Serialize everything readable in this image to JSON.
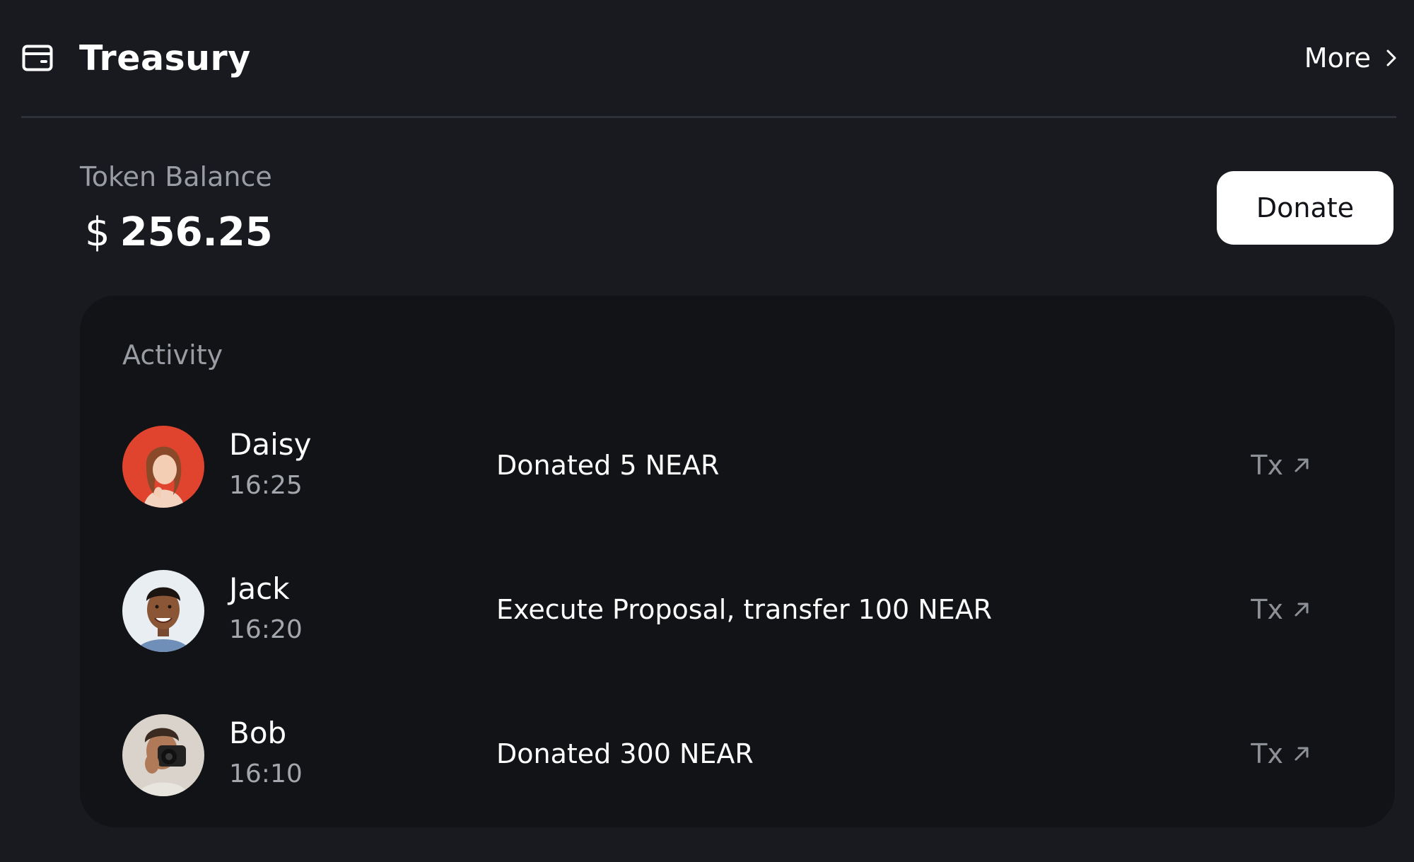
{
  "header": {
    "icon": "wallet-icon",
    "title": "Treasury",
    "more_label": "More",
    "more_icon": "chevron-right-icon"
  },
  "balance": {
    "label": "Token Balance",
    "currency": "$",
    "amount": "256.25"
  },
  "donate_button": {
    "label": "Donate"
  },
  "activity": {
    "title": "Activity",
    "items": [
      {
        "name": "Daisy",
        "time": "16:25",
        "description": "Donated 5 NEAR",
        "tx_label": "Tx",
        "avatar_bg": "#e0442f"
      },
      {
        "name": "Jack",
        "time": "16:20",
        "description": "Execute Proposal, transfer 100 NEAR",
        "tx_label": "Tx",
        "avatar_bg": "#e9eef2"
      },
      {
        "name": "Bob",
        "time": "16:10",
        "description": "Donated 300 NEAR",
        "tx_label": "Tx",
        "avatar_bg": "#d9d3cb"
      }
    ]
  },
  "colors": {
    "background": "#181a20",
    "card": "#121317",
    "muted_text": "#9a9ca3",
    "button_bg": "#ffffff",
    "button_text": "#111318"
  }
}
